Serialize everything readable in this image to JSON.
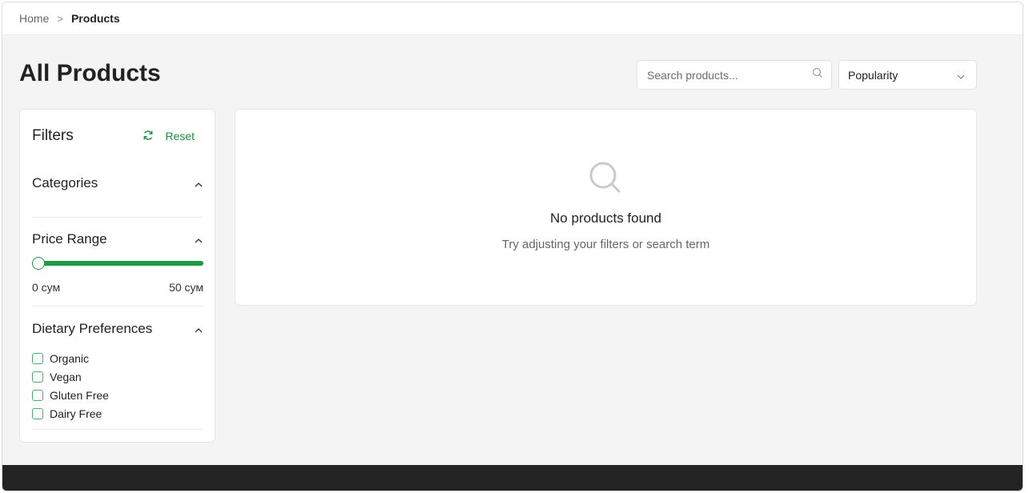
{
  "breadcrumb": {
    "home": "Home",
    "separator": ">",
    "current": "Products"
  },
  "page": {
    "title": "All Products"
  },
  "search": {
    "placeholder": "Search products...",
    "value": ""
  },
  "sort": {
    "selected": "Popularity"
  },
  "filters": {
    "title": "Filters",
    "reset_label": "Reset",
    "categories": {
      "label": "Categories",
      "expanded": true
    },
    "price_range": {
      "label": "Price Range",
      "min_label": "0 сум",
      "max_label": "50 сум",
      "value_fraction": 0
    },
    "dietary": {
      "label": "Dietary Preferences",
      "options": [
        {
          "label": "Organic",
          "checked": false
        },
        {
          "label": "Vegan",
          "checked": false
        },
        {
          "label": "Gluten Free",
          "checked": false
        },
        {
          "label": "Dairy Free",
          "checked": false
        }
      ]
    }
  },
  "results": {
    "empty_title": "No products found",
    "empty_subtitle": "Try adjusting your filters or search term"
  },
  "colors": {
    "accent": "#1e9a45",
    "footer": "#242424",
    "background": "#f4f4f4"
  },
  "icons": {
    "search": "search-icon",
    "reset": "refresh-icon",
    "chevron_up": "chevron-up-icon",
    "chevron_down": "chevron-down-icon"
  }
}
